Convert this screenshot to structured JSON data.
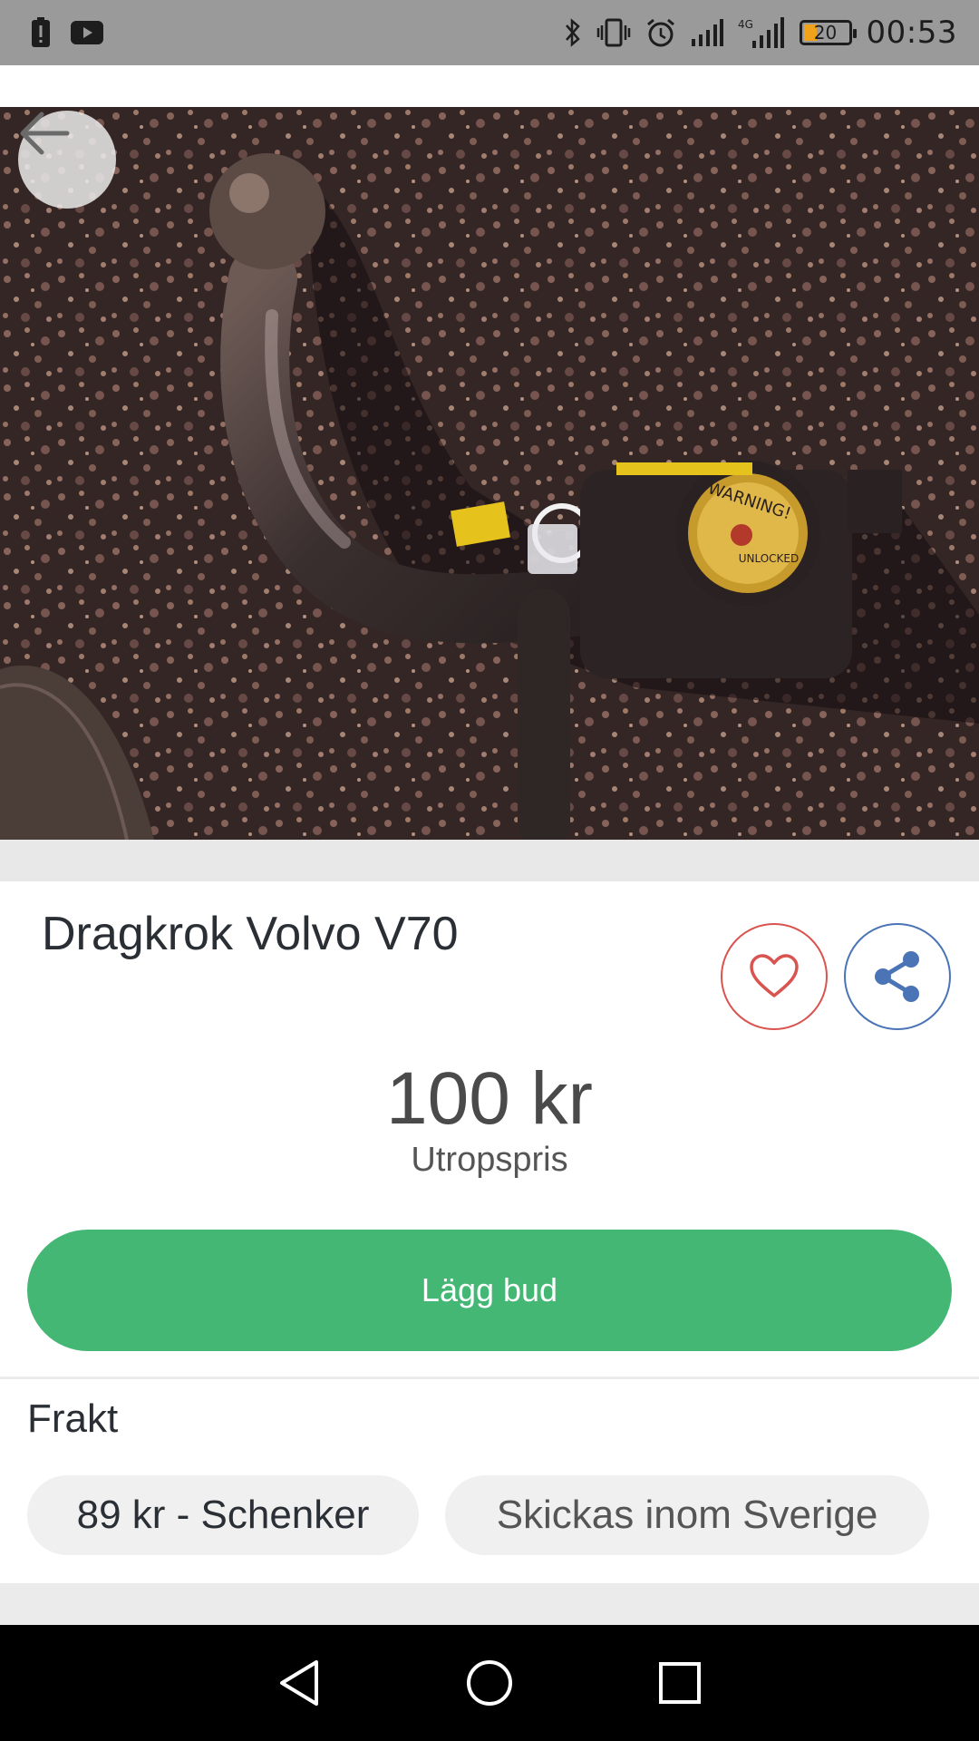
{
  "status_bar": {
    "time": "00:53",
    "battery_level": "20",
    "icons": [
      "alert-icon",
      "youtube-icon",
      "bluetooth-icon",
      "vibrate-icon",
      "alarm-icon",
      "signal-icon",
      "4g-signal-icon",
      "battery-icon"
    ]
  },
  "listing": {
    "title": "Dragkrok Volvo V70",
    "price": "100 kr",
    "price_label": "Utropspris",
    "bid_button": "Lägg bud"
  },
  "shipping": {
    "label": "Frakt",
    "options": [
      "89 kr - Schenker",
      "Skickas inom Sverige"
    ]
  },
  "colors": {
    "accent_green": "#45b775",
    "favorite_red": "#d9534f",
    "share_blue": "#4a74b5"
  }
}
